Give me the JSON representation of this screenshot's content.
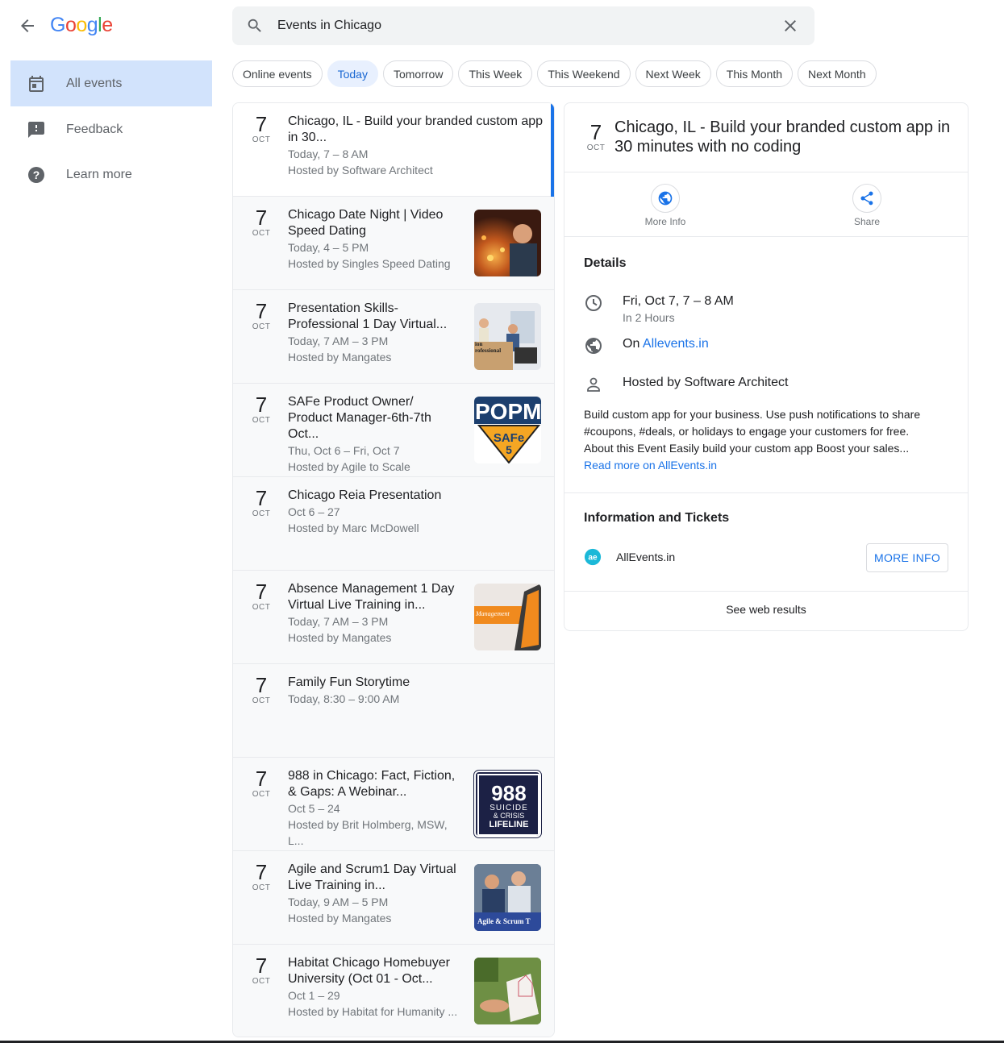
{
  "header": {
    "logo": "Google",
    "search_value": "Events in Chicago"
  },
  "sidebar": {
    "items": [
      {
        "label": "All events",
        "icon": "calendar-icon"
      },
      {
        "label": "Feedback",
        "icon": "feedback-icon"
      },
      {
        "label": "Learn more",
        "icon": "help-icon"
      }
    ]
  },
  "chips": [
    "Online events",
    "Today",
    "Tomorrow",
    "This Week",
    "This Weekend",
    "Next Week",
    "This Month",
    "Next Month"
  ],
  "events": [
    {
      "day": "7",
      "month": "OCT",
      "title": "Chicago, IL - Build your branded custom app in 30...",
      "time": "Today, 7 – 8 AM",
      "host": "Hosted by Software Architect"
    },
    {
      "day": "7",
      "month": "OCT",
      "title": "Chicago Date Night | Video Speed Dating",
      "time": "Today, 4 – 5 PM",
      "host": "Hosted by Singles Speed Dating"
    },
    {
      "day": "7",
      "month": "OCT",
      "title": "Presentation Skills-Professional 1 Day Virtual...",
      "time": "Today, 7 AM – 3 PM",
      "host": "Hosted by Mangates",
      "thumb_text": "ion rofessional"
    },
    {
      "day": "7",
      "month": "OCT",
      "title": "SAFe Product Owner/ Product Manager-6th-7th Oct...",
      "time": "Thu, Oct 6 – Fri, Oct 7",
      "host": "Hosted by Agile to Scale",
      "thumb_text": "POPM",
      "thumb_text2": "SAFe",
      "thumb_text3": "5"
    },
    {
      "day": "7",
      "month": "OCT",
      "title": "Chicago Reia Presentation",
      "time": "Oct 6 – 27",
      "host": "Hosted by Marc McDowell"
    },
    {
      "day": "7",
      "month": "OCT",
      "title": "Absence Management 1 Day Virtual Live Training in...",
      "time": "Today, 7 AM – 3 PM",
      "host": "Hosted by Mangates",
      "thumb_text": "Management"
    },
    {
      "day": "7",
      "month": "OCT",
      "title": "Family Fun Storytime",
      "time": "Today, 8:30 – 9:00 AM",
      "host": ""
    },
    {
      "day": "7",
      "month": "OCT",
      "title": "988 in Chicago: Fact, Fiction, & Gaps: A Webinar...",
      "time": "Oct 5 – 24",
      "host": "Hosted by Brit Holmberg, MSW, L...",
      "thumb_text": "988",
      "thumb_text2": "SUICIDE",
      "thumb_text3": "& CRISIS",
      "thumb_text4": "LIFELINE"
    },
    {
      "day": "7",
      "month": "OCT",
      "title": "Agile and Scrum1 Day Virtual Live Training in...",
      "time": "Today, 9 AM – 5 PM",
      "host": "Hosted by Mangates",
      "thumb_text": "Agile & Scrum T"
    },
    {
      "day": "7",
      "month": "OCT",
      "title": "Habitat Chicago Homebuyer University (Oct 01 - Oct...",
      "time": "Oct 1 – 29",
      "host": "Hosted by Habitat for Humanity ..."
    }
  ],
  "detail": {
    "day": "7",
    "month": "OCT",
    "title": "Chicago, IL - Build your branded custom app in 30 minutes with no coding",
    "more_info": "More Info",
    "share": "Share",
    "details_heading": "Details",
    "when": "Fri, Oct 7, 7 – 8 AM",
    "when_sub": "In 2 Hours",
    "on_prefix": "On ",
    "on_link": "Allevents.in",
    "host": "Hosted by Software Architect",
    "description": "Build custom app for your business. Use push notifications to share #coupons, #deals, or holidays to engage your customers for free. About this Event Easily build your custom app Boost your sales...",
    "read_more": "Read more on AllEvents.in",
    "tickets_heading": "Information and Tickets",
    "provider": "AllEvents.in",
    "more_info_button": "MORE INFO",
    "see_web": "See web results"
  },
  "colors": {
    "accent": "#1a73e8",
    "selected_nav": "#d2e3fc",
    "chip_selected": "#e8f0fe"
  }
}
